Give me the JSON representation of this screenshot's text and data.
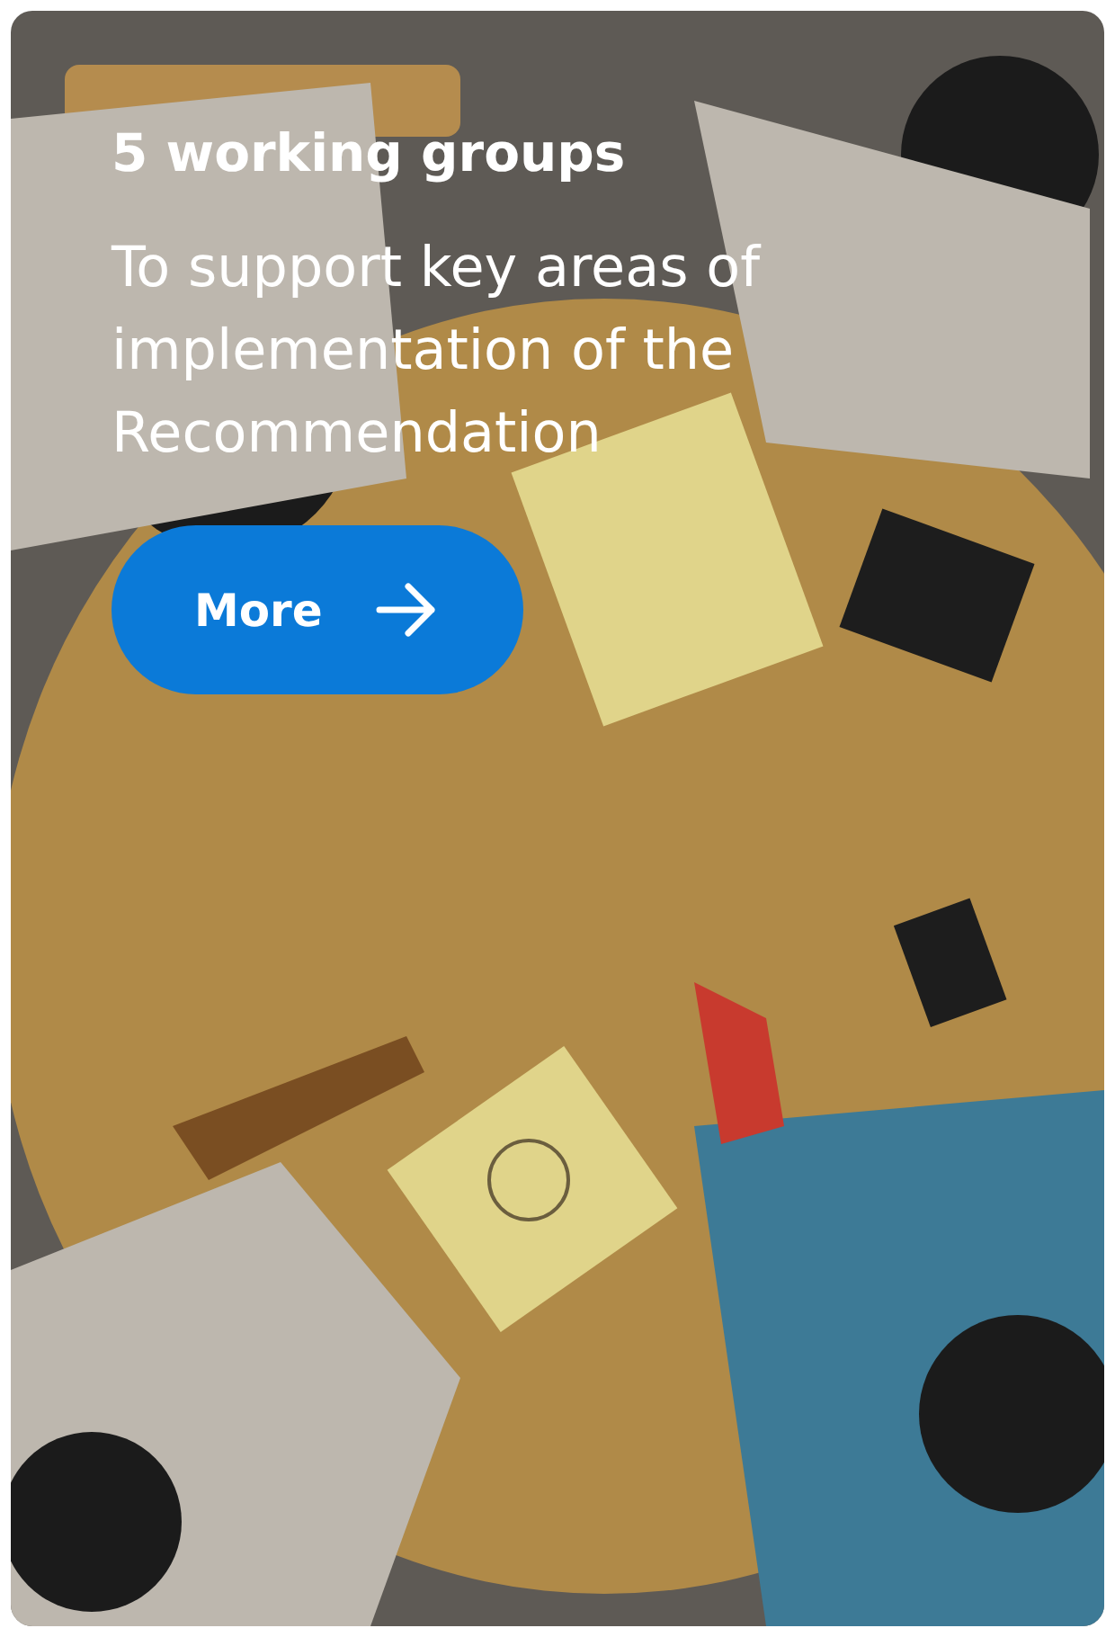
{
  "card": {
    "title": "5 working groups",
    "description": "To support key areas of implementation of the Recommendation",
    "button": {
      "label": "More"
    }
  }
}
